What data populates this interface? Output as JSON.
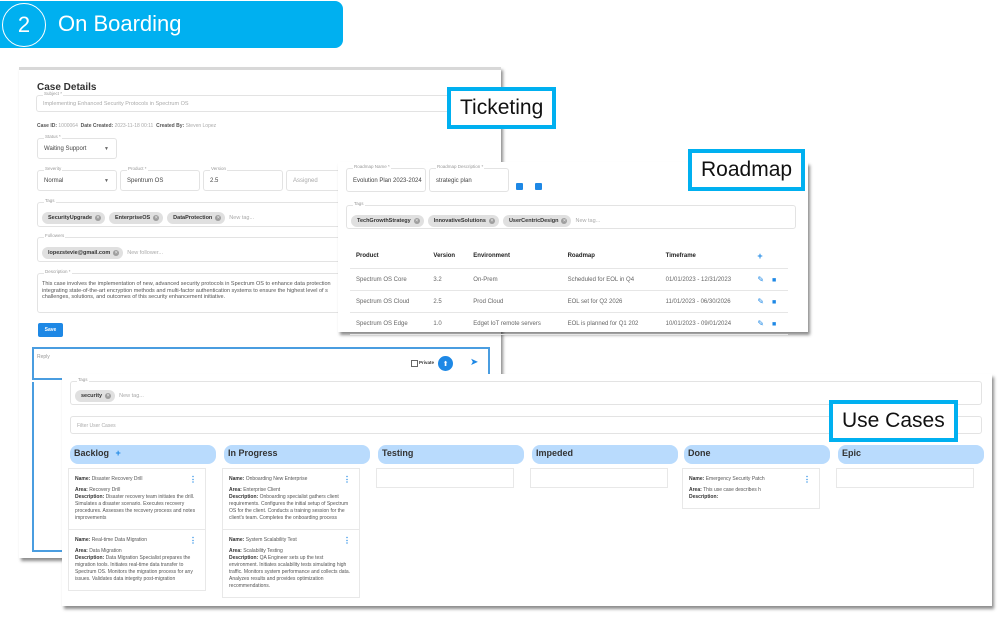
{
  "banner": {
    "step": "2",
    "title": "On Boarding"
  },
  "labels": {
    "ticketing": "Ticketing",
    "roadmap": "Roadmap",
    "use_cases": "Use Cases"
  },
  "ticketing": {
    "heading": "Case Details",
    "subject_label": "Subject *",
    "subject": "Implementing Enhanced Security Protocols in Spectrum OS",
    "meta": {
      "case_id_label": "Case ID:",
      "case_id": "1000064",
      "date_label": "Date Created:",
      "date": "2023-11-18 00:11",
      "created_by_label": "Created By:",
      "created_by": "Steven Lopez"
    },
    "status_label": "Status *",
    "status": "Waiting Support",
    "severity_label": "Severity",
    "severity": "Normal",
    "product_label": "Product *",
    "product": "Spentrum OS",
    "version_label": "Version",
    "version": "2.5",
    "assigned_placeholder": "Assigned",
    "tags_label": "Tags",
    "tags": [
      "SecurityUpgrade",
      "EnterpriseOS",
      "DataProtection"
    ],
    "new_tag_placeholder": "New tag...",
    "followers_label": "Followers",
    "followers": [
      "lopezstevie@gmail.com"
    ],
    "new_follower_placeholder": "New follower...",
    "description_label": "Description *",
    "description": "This case involves the implementation of new, advanced security protocols in Spectrum OS to enhance data protection integrating state-of-the-art encryption methods and multi-factor authentication systems to ensure the highest level of s challenges, solutions, and outcomes of this security enhancement initiative.",
    "save": "Save",
    "reply_placeholder": "Reply",
    "private_label": "Private"
  },
  "roadmap": {
    "name_label": "Roadmap Name *",
    "name": "Evolution Plan 2023-2024",
    "desc_label": "Roadmap Description *",
    "desc": "strategic plan",
    "tags_label": "Tags",
    "tags": [
      "TechGrowthStrategy",
      "InnovativeSolutions",
      "UserCentricDesign"
    ],
    "new_tag_placeholder": "New tag...",
    "columns": [
      "Product",
      "Version",
      "Environment",
      "Roadmap",
      "Timeframe"
    ],
    "rows": [
      {
        "product": "Spectrum OS Core",
        "version": "3.2",
        "environment": "On-Prem",
        "roadmap": "Scheduled for EOL in Q4",
        "timeframe": "01/01/2023 - 12/31/2023"
      },
      {
        "product": "Spectrum OS Cloud",
        "version": "2.5",
        "environment": "Prod Cloud",
        "roadmap": "EOL set for Q2 2026",
        "timeframe": "11/01/2023 - 06/30/2026"
      },
      {
        "product": "Spectrum OS Edge",
        "version": "1.0",
        "environment": "Edget IoT remote servers",
        "roadmap": "EOL is planned for Q1 202",
        "timeframe": "10/01/2023 - 09/01/2024"
      }
    ]
  },
  "use_cases": {
    "tags_label": "Tags",
    "tags": [
      "security"
    ],
    "new_tag_placeholder": "New tag...",
    "filter_placeholder": "Filter User Cases",
    "name_key": "Name:",
    "area_key": "Area:",
    "desc_key": "Description:",
    "columns": [
      {
        "title": "Backlog",
        "cards": [
          {
            "name": "Disaster Recovery Drill",
            "area": "Recovery Drill",
            "description": "Disaster recovery team initiates the drill. Simulates a disaster scenario. Executes recovery procedures. Assesses the recovery process and notes improvements"
          },
          {
            "name": "Real-time Data Migration",
            "area": "Data Migration",
            "description": "Data Migration Specialist prepares the migration tools. Initiates real-time data transfer to Spectrum OS. Monitors the migration process for any issues. Validates data integrity post-migration"
          }
        ]
      },
      {
        "title": "In Progress",
        "cards": [
          {
            "name": "Onboarding New Enterprise",
            "area": "Enterprise Client",
            "description": "Onboarding specialist gathers client requirements. Configures the initial setup of Spectrum OS for the client. Conducts a training session for the client's team. Completes the onboarding process"
          },
          {
            "name": "System Scalability Test",
            "area": "Scalability Testing",
            "description": "QA Engineer sets up the test environment. Initiates scalability tests simulating high traffic. Monitors system performance and collects data. Analyzes results and provides optimization recommendations."
          }
        ]
      },
      {
        "title": "Testing",
        "cards": []
      },
      {
        "title": "Impeded",
        "cards": []
      },
      {
        "title": "Done",
        "cards": [
          {
            "name": "Emergency Security Patch",
            "area": "This use case describes h",
            "description": ""
          }
        ]
      },
      {
        "title": "Epic",
        "cards": []
      }
    ]
  }
}
